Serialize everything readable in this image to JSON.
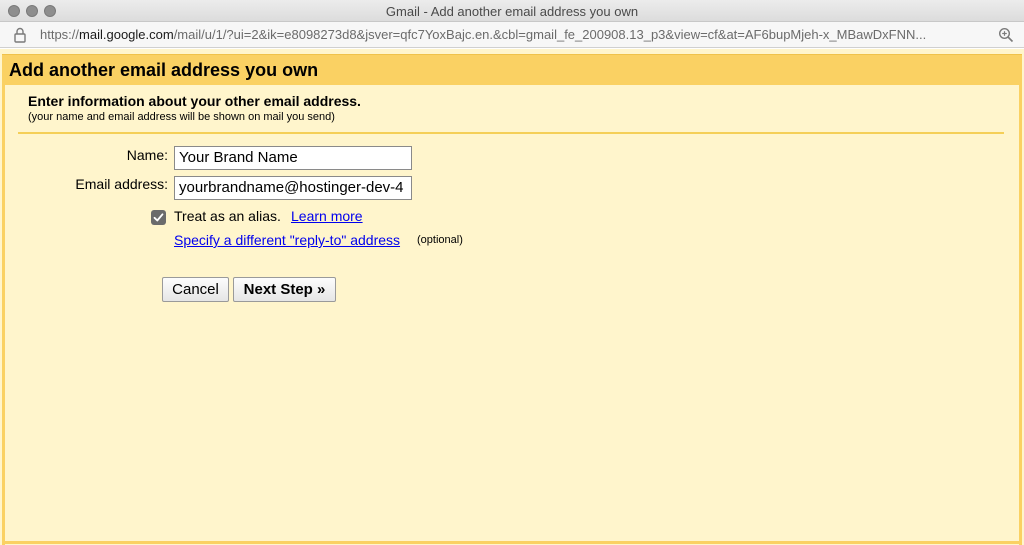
{
  "window": {
    "title": "Gmail - Add another email address you own"
  },
  "urlbar": {
    "scheme": "https://",
    "host": "mail.google.com",
    "path": "/mail/u/1/?ui=2&ik=e8098273d8&jsver=qfc7YoxBajc.en.&cbl=gmail_fe_200908.13_p3&view=cf&at=AF6bupMjeh-x_MBawDxFNN..."
  },
  "dialog": {
    "title": "Add another email address you own",
    "intro_heading": "Enter information about your other email address.",
    "intro_sub": "(your name and email address will be shown on mail you send)",
    "name_label": "Name:",
    "name_value": "Your Brand Name",
    "email_label": "Email address:",
    "email_value": "yourbrandname@hostinger-dev-4",
    "alias_checked": true,
    "alias_label": "Treat as an alias.",
    "learn_more": "Learn more",
    "reply_to_link": "Specify a different \"reply-to\" address",
    "reply_to_optional": "(optional)",
    "cancel_label": "Cancel",
    "next_label": "Next Step »"
  },
  "colors": {
    "header_bg": "#fad163",
    "page_bg": "#fff5cc",
    "link": "#0000ee"
  }
}
